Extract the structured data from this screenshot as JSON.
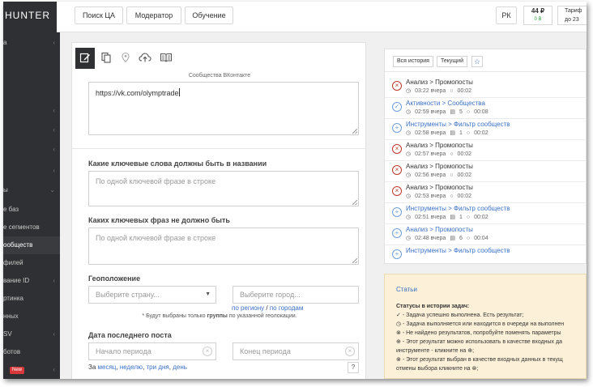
{
  "app": {
    "logo": "HUNTER"
  },
  "topbar": {
    "buttons": [
      "Поиск ЦА",
      "Модератор",
      "Обучение"
    ],
    "region": "РК",
    "balance": {
      "amount": "44 ₽",
      "points": "0 В"
    },
    "tariff": {
      "label": "Тариф",
      "until": "до 23"
    }
  },
  "sidebar": {
    "items": [
      {
        "label": "а"
      },
      {
        "label": ""
      },
      {
        "label": ""
      },
      {
        "label": ""
      },
      {
        "label": ""
      },
      {
        "label": "ы"
      },
      {
        "label": "е баз"
      },
      {
        "label": "е сегментов"
      },
      {
        "label": "ообществ"
      },
      {
        "label": "филей"
      },
      {
        "label": "вание ID"
      },
      {
        "label": "ртинка"
      },
      {
        "label": "нных"
      },
      {
        "label": "SV"
      },
      {
        "label": "ботов"
      },
      {
        "label": "",
        "badge": "New"
      }
    ]
  },
  "form": {
    "communities_label": "Сообщества ВКонтакте",
    "communities_value": "https://vk.com/olymptrade",
    "include_title": "Какие ключевые слова должны быть в названии",
    "include_placeholder": "По одной ключевой фразе в строке",
    "exclude_title": "Каких ключевых фраз не должно быть",
    "exclude_placeholder": "По одной ключевой фразе в строке",
    "geo_title": "Геоположение",
    "country_placeholder": "Выберите страну...",
    "city_placeholder": "Выберите город...",
    "by_region": "по региону",
    "sep": " / ",
    "by_cities": "по городам",
    "geo_note_pre": "* Будут выбраны только ",
    "geo_note_bold": "группы",
    "geo_note_post": " по указанной геолокации.",
    "date_title": "Дата последнего поста",
    "period_start": "Начало периода",
    "period_end": "Конец периода",
    "quick_prefix": "За ",
    "quick": [
      "месяц",
      "неделю",
      "три дня",
      "день"
    ],
    "help": "?"
  },
  "history": {
    "tabs": [
      "Вся история",
      "Текущий"
    ],
    "star": "☆",
    "rows": [
      {
        "status": "err",
        "title": "Анализ > Промопосты",
        "time": "03:22 вчера",
        "files": "",
        "dur": "00:02"
      },
      {
        "status": "ok",
        "title": "Активности > Сообщества",
        "time": "02:59 вчера",
        "files": "5",
        "dur": "00:08"
      },
      {
        "status": "add",
        "title": "Инструменты > Фильтр сообществ",
        "time": "02:58 вчера",
        "files": "1",
        "dur": "00:02"
      },
      {
        "status": "err",
        "title": "Анализ > Промопосты",
        "time": "02:57 вчера",
        "files": "",
        "dur": "00:02"
      },
      {
        "status": "err",
        "title": "Анализ > Промопосты",
        "time": "02:56 вчера",
        "files": "",
        "dur": "00:02"
      },
      {
        "status": "err",
        "title": "Анализ > Промопосты",
        "time": "02:53 вчера",
        "files": "",
        "dur": "00:02"
      },
      {
        "status": "add",
        "title": "Инструменты > Фильтр сообществ",
        "time": "02:51 вчера",
        "files": "1",
        "dur": "00:02"
      },
      {
        "status": "add",
        "title": "Анализ > Промопосты",
        "time": "02:48 вчера",
        "files": "6",
        "dur": "00:04"
      },
      {
        "status": "add",
        "title": "Инструменты > Фильтр сообществ",
        "time": "",
        "files": "",
        "dur": ""
      }
    ]
  },
  "stats": {
    "header": "Статьи",
    "title": "Статусы в истории задач:",
    "lines": [
      "- Задача успешно выполнена. Есть результат;",
      "- Задача выполняется или находится в очереди на выполнен",
      "- Не найдено результатов, попробуйте поменять параметры",
      "- Этот результат можно использовать в качестве входных да",
      "инструменте - кликните на",
      "- Этот результат выбран в качестве входных данных в текущ",
      "отмены выбора кликните на"
    ]
  },
  "colors": {
    "accent": "#3a6fc4",
    "sidebar": "#2f3033",
    "error": "#c0392b",
    "note_bg": "#fcf1d8"
  }
}
